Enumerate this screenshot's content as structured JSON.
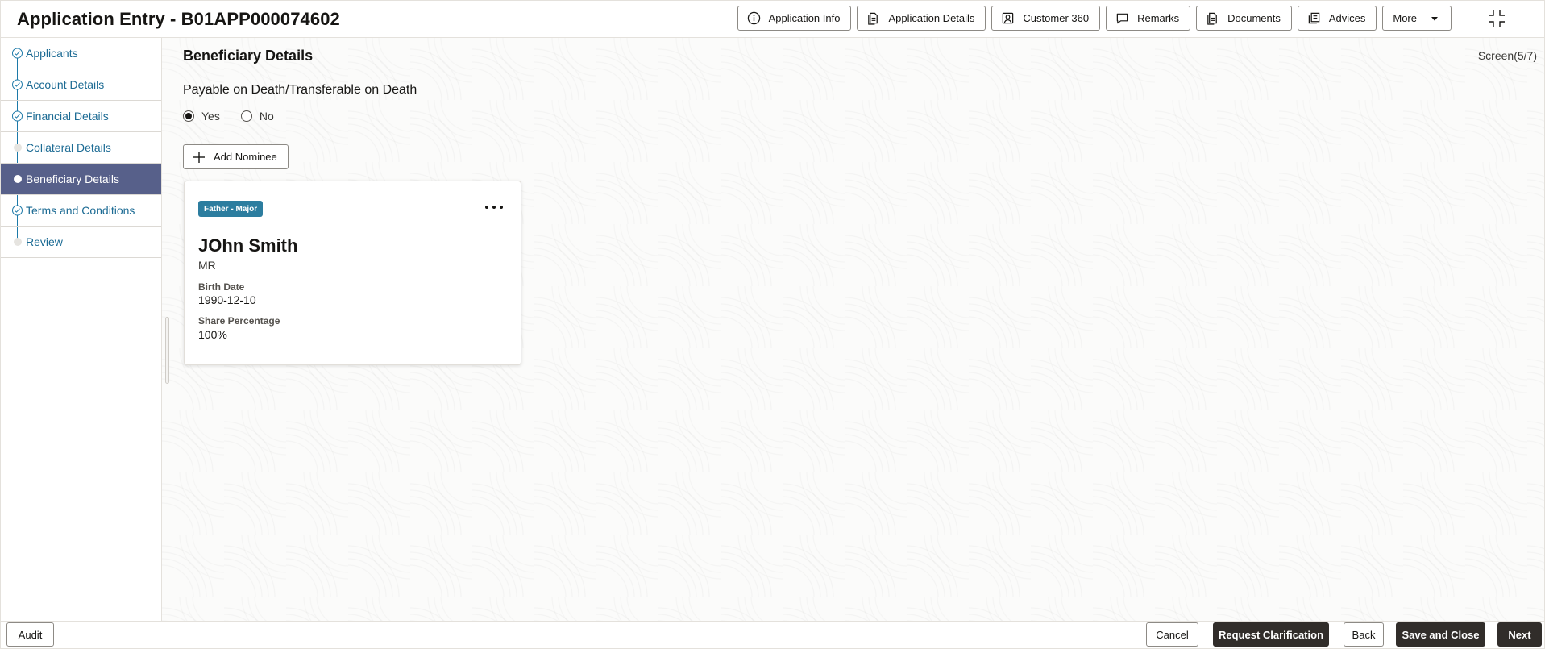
{
  "header": {
    "title": "Application Entry - B01APP000074602",
    "toolbar": [
      {
        "label": "Application Info",
        "icon": "info-icon"
      },
      {
        "label": "Application Details",
        "icon": "document-icon"
      },
      {
        "label": "Customer 360",
        "icon": "customer-icon"
      },
      {
        "label": "Remarks",
        "icon": "comment-icon"
      },
      {
        "label": "Documents",
        "icon": "document-icon"
      },
      {
        "label": "Advices",
        "icon": "advices-icon"
      },
      {
        "label": "More",
        "icon": "caret-down-icon"
      }
    ]
  },
  "sidebar": {
    "steps": [
      {
        "label": "Applicants",
        "status": "done"
      },
      {
        "label": "Account Details",
        "status": "done"
      },
      {
        "label": "Financial Details",
        "status": "done"
      },
      {
        "label": "Collateral Details",
        "status": "pending"
      },
      {
        "label": "Beneficiary Details",
        "status": "current"
      },
      {
        "label": "Terms and Conditions",
        "status": "done"
      },
      {
        "label": "Review",
        "status": "pending"
      }
    ]
  },
  "main": {
    "section_title": "Beneficiary Details",
    "screen_counter": "Screen(5/7)",
    "pod_question": "Payable on Death/Transferable on Death",
    "pod_options": [
      {
        "label": "Yes",
        "selected": true
      },
      {
        "label": "No",
        "selected": false
      }
    ],
    "add_nominee_label": "Add Nominee",
    "nominee_card": {
      "badge": "Father - Major",
      "name": "JOhn Smith",
      "title": "MR",
      "birth_date_label": "Birth Date",
      "birth_date": "1990-12-10",
      "share_label": "Share Percentage",
      "share": "100%"
    }
  },
  "footer": {
    "audit": "Audit",
    "cancel": "Cancel",
    "request_clarification": "Request Clarification",
    "back": "Back",
    "save_and_close": "Save and Close",
    "next": "Next"
  },
  "colors": {
    "accent": "#1c79a8",
    "active_step_bg": "#57608a",
    "badge_bg": "#2c7d9f",
    "primary_button": "#312d2a"
  }
}
